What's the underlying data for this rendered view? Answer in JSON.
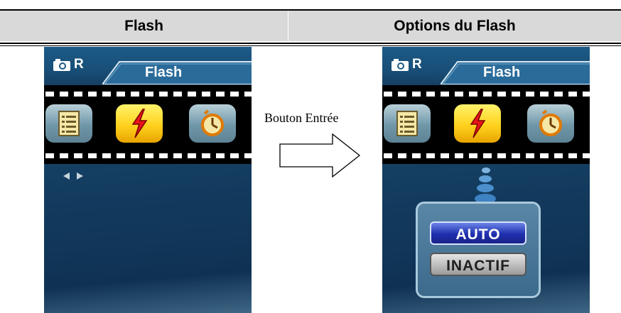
{
  "table": {
    "col_left": "Flash",
    "col_right": "Options du Flash"
  },
  "left_screen": {
    "mode_letter": "R",
    "tab_label": "Flash",
    "icons": [
      "menu-list-icon",
      "flash-icon",
      "self-timer-icon"
    ],
    "selected_icon": "flash-icon",
    "nav_hint": "left-right-arrows-icon"
  },
  "transition": {
    "label": "Bouton Entrée",
    "arrow_icon": "right-arrow-icon"
  },
  "right_screen": {
    "mode_letter": "R",
    "tab_label": "Flash",
    "icons": [
      "menu-list-icon",
      "flash-icon",
      "self-timer-icon"
    ],
    "selected_icon": "flash-icon",
    "options": [
      "AUTO",
      "INACTIF"
    ],
    "selected_option": "AUTO"
  },
  "colors": {
    "screen_bg": "#164468",
    "selected_button": "#ffd21e",
    "highlight_option": "#1e2fae"
  }
}
